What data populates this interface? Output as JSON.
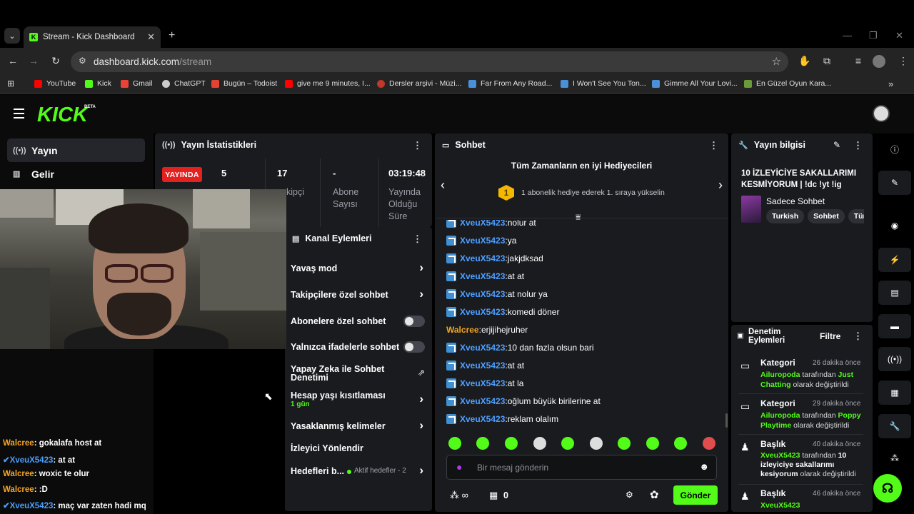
{
  "browser": {
    "tab_title": "Stream - Kick Dashboard",
    "tab_favicon": "K",
    "url_host": "dashboard.kick.com",
    "url_path": "/stream",
    "bookmarks": [
      {
        "label": "YouTube",
        "color": "#ff0000"
      },
      {
        "label": "Kick",
        "color": "#53fc18"
      },
      {
        "label": "Gmail",
        "color": "#ea4335"
      },
      {
        "label": "ChatGPT",
        "color": "#cccccc"
      },
      {
        "label": "Bugün – Todoist",
        "color": "#e44332"
      },
      {
        "label": "give me 9 minutes, I...",
        "color": "#ff0000"
      },
      {
        "label": "Dersler arşivi - Müzi...",
        "color": "#c0392b"
      },
      {
        "label": "Far From Any Road...",
        "color": "#4a90d9"
      },
      {
        "label": "I Won't See You Ton...",
        "color": "#4a90d9"
      },
      {
        "label": "Gimme All Your Lovi...",
        "color": "#4a90d9"
      },
      {
        "label": "En Güzel Oyun Kara...",
        "color": "#6a9a3a"
      }
    ]
  },
  "kick": {
    "logo": "KICK",
    "beta": "BETA",
    "accent": "#53fc18",
    "sidebar": [
      {
        "label": "Yayın",
        "icon": "broadcast-icon"
      },
      {
        "label": "Gelir",
        "icon": "revenue-icon"
      }
    ]
  },
  "overlay_chat": [
    {
      "user": "Walcree",
      "sep": ": ",
      "text": "gokalafa host at",
      "color": "#f5a623"
    },
    {
      "user": "XveuX5423",
      "sep": ": ",
      "text": "at at",
      "color": "#4d9fff"
    },
    {
      "user": "Walcree",
      "sep": ": ",
      "text": "woxic te olur",
      "color": "#f5a623"
    },
    {
      "user": "Walcree",
      "sep": ": ",
      "text": ":D",
      "color": "#f5a623"
    },
    {
      "user": "XveuX5423",
      "sep": ": ",
      "text": "maç var zaten hadi mq",
      "color": "#4d9fff"
    }
  ],
  "stats": {
    "title": "Yayın İstatistikleri",
    "live": "YAYINDA",
    "viewers": "5",
    "followers": "17",
    "followers_label": "kipçi",
    "subs": "-",
    "subs_label": "Abone Sayısı",
    "duration": "03:19:48",
    "duration_label": "Yayında Olduğu Süre"
  },
  "channel_actions": {
    "title": "Kanal Eylemleri",
    "items": [
      {
        "label": "Yavaş mod"
      },
      {
        "label": "Takipçilere özel sohbet"
      },
      {
        "label": "Abonelere özel sohbet"
      },
      {
        "label": "Yalnızca ifadelerle sohbet"
      },
      {
        "label": "Yapay Zeka ile Sohbet Denetimi"
      },
      {
        "label": "Hesap yaşı kısıtlaması",
        "sub": "1 gün"
      },
      {
        "label": "Yasaklanmış kelimeler"
      },
      {
        "label": "İzleyici Yönlendir"
      },
      {
        "label": "Hedefleri b...",
        "sub": "Aktif hedefler - 2"
      }
    ]
  },
  "chat": {
    "title": "Sohbet",
    "gifters_title": "Tüm Zamanların en iyi Hediyecileri",
    "gifters_rank": "1",
    "gifters_text": "1 abonelik hediye ederek 1. sıraya yükselin",
    "messages": [
      {
        "user": "XveuX5423",
        "text": "nolur at",
        "color": "#4d9fff",
        "badge": true
      },
      {
        "user": "XveuX5423",
        "text": "ya",
        "color": "#4d9fff",
        "badge": true
      },
      {
        "user": "XveuX5423",
        "text": "jakjdksad",
        "color": "#4d9fff",
        "badge": true
      },
      {
        "user": "XveuX5423",
        "text": "at at",
        "color": "#4d9fff",
        "badge": true
      },
      {
        "user": "XveuX5423",
        "text": "at nolur ya",
        "color": "#4d9fff",
        "badge": true
      },
      {
        "user": "XveuX5423",
        "text": "komedi döner",
        "color": "#4d9fff",
        "badge": true
      },
      {
        "user": "Walcree",
        "text": "erjijihejruher",
        "color": "#f5a623",
        "badge": false
      },
      {
        "user": "XveuX5423",
        "text": "10 dan fazla olsun bari",
        "color": "#4d9fff",
        "badge": true
      },
      {
        "user": "XveuX5423",
        "text": "at at",
        "color": "#4d9fff",
        "badge": true
      },
      {
        "user": "XveuX5423",
        "text": "at la",
        "color": "#4d9fff",
        "badge": true
      },
      {
        "user": "XveuX5423",
        "text": "oğlum büyük birilerine at",
        "color": "#4d9fff",
        "badge": true
      },
      {
        "user": "XveuX5423",
        "text": "reklam olalım",
        "color": "#4d9fff",
        "badge": true
      }
    ],
    "input_placeholder": "Bir mesaj gönderin",
    "points": "0",
    "send": "Gönder"
  },
  "stream_info": {
    "title_label": "Yayın bilgisi",
    "stream_title": "10 İZLEYİCİYE SAKALLARIMI KESMİYORUM | !dc !yt !ig",
    "category": "Sadece Sohbet",
    "tags": [
      "Turkish",
      "Sohbet",
      "Türk"
    ]
  },
  "mod_actions": {
    "title": "Denetim Eylemleri",
    "filter": "Filtre",
    "items": [
      {
        "type": "Kategori",
        "time": "26 dakika önce",
        "actor": "Ailuropoda",
        "mid": " tarafından ",
        "value": "Just Chatting",
        "suffix": " olarak değiştirildi"
      },
      {
        "type": "Kategori",
        "time": "29 dakika önce",
        "actor": "Ailuropoda",
        "mid": " tarafından ",
        "value": "Poppy Playtime",
        "suffix": " olarak değiştirildi"
      },
      {
        "type": "Başlık",
        "time": "40 dakika önce",
        "actor": "XveuX5423",
        "mid": " tarafından ",
        "value": "10 izleyiciye sakallarımı kesiyorum",
        "suffix": " olarak değiştirildi"
      },
      {
        "type": "Başlık",
        "time": "46 dakika önce",
        "actor": "XveuX5423",
        "mid": " tarafından ",
        "value": "",
        "suffix": ""
      }
    ]
  }
}
